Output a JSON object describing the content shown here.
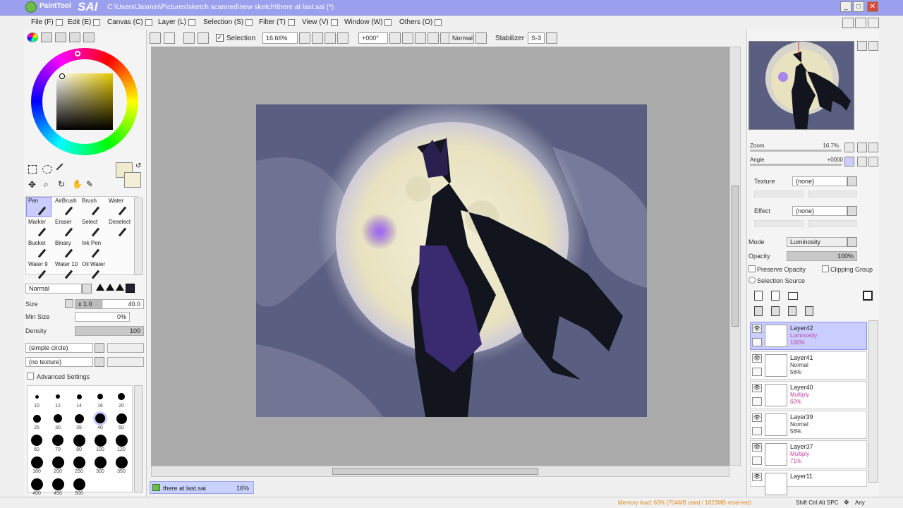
{
  "window": {
    "app_name": "PaintTool",
    "app_logo_text": "SAI",
    "title": "C:\\Users\\Jasmin\\Pictures\\sketch scanned\\new sketch\\there at last.sai (*)",
    "min_label": "_",
    "max_label": "□",
    "close_label": "✕"
  },
  "menu": [
    "File (F)",
    "Edit (E)",
    "Canvas (C)",
    "Layer (L)",
    "Selection (S)",
    "Filter (T)",
    "View (V)",
    "Window (W)",
    "Others (O)"
  ],
  "toolbar": {
    "selection_label": "Selection",
    "zoom": "16.66%",
    "angle": "+000°",
    "mode": "Normal",
    "stabilizer_label": "Stabilizer",
    "stabilizer_value": "S-3"
  },
  "tools": [
    {
      "label": "Pen"
    },
    {
      "label": "AirBrush"
    },
    {
      "label": "Brush"
    },
    {
      "label": "Water"
    },
    {
      "label": "Marker"
    },
    {
      "label": "Eraser"
    },
    {
      "label": "Select"
    },
    {
      "label": "Deselect"
    },
    {
      "label": "Bucket"
    },
    {
      "label": "Binary"
    },
    {
      "label": "Ink Pen"
    },
    {
      "label": ""
    },
    {
      "label": "Water 9"
    },
    {
      "label": "Water 10"
    },
    {
      "label": "Oil Water"
    },
    {
      "label": ""
    }
  ],
  "brush": {
    "blend_mode": "Normal",
    "size_label": "Size",
    "size_mult": "x 1.0",
    "size_value": "40.0",
    "min_size_label": "Min Size",
    "min_size_value": "0%",
    "density_label": "Density",
    "density_value": "100",
    "shape": "(simple circle)",
    "texture": "(no texture)",
    "advanced_label": "Advanced Settings"
  },
  "brush_sizes": [
    "10",
    "12",
    "14",
    "16",
    "20",
    "25",
    "30",
    "35",
    "40",
    "50",
    "60",
    "70",
    "80",
    "100",
    "120",
    "160",
    "200",
    "250",
    "300",
    "350",
    "400",
    "450",
    "500"
  ],
  "navigator": {
    "zoom_label": "Zoom",
    "zoom_value": "16.7%",
    "angle_label": "Angle",
    "angle_value": "+0000"
  },
  "layer_props": {
    "texture_label": "Texture",
    "texture_value": "(none)",
    "effect_label": "Effect",
    "effect_value": "(none)",
    "mode_label": "Mode",
    "mode_value": "Luminosity",
    "opacity_label": "Opacity",
    "opacity_value": "100%",
    "preserve_opacity": "Preserve Opacity",
    "clipping_group": "Clipping Group",
    "selection_source": "Selection Source"
  },
  "layers": [
    {
      "name": "Layer42",
      "mode": "Luminosity",
      "opacity": "100%",
      "selected": true
    },
    {
      "name": "Layer41",
      "mode": "Normal",
      "opacity": "56%",
      "selected": false
    },
    {
      "name": "Layer40",
      "mode": "Multiply",
      "opacity": "60%",
      "selected": false
    },
    {
      "name": "Layer39",
      "mode": "Normal",
      "opacity": "56%",
      "selected": false
    },
    {
      "name": "Layer37",
      "mode": "Multiply",
      "opacity": "71%",
      "selected": false
    },
    {
      "name": "Layer11",
      "mode": "",
      "opacity": "",
      "selected": false
    }
  ],
  "document_tab": {
    "name": "there at last.sai",
    "zoom": "16%"
  },
  "status": {
    "memory": "Memory load: 63% (704MB used / 1823MB reserved)",
    "keys": "Shift Ctrl Alt SPC",
    "any": "Any"
  },
  "colors": {
    "accent": "#9aa0ee",
    "layer_selected": "#c9cdff",
    "memory_text": "#e08a1e",
    "mode_pink": "#c040a0"
  }
}
